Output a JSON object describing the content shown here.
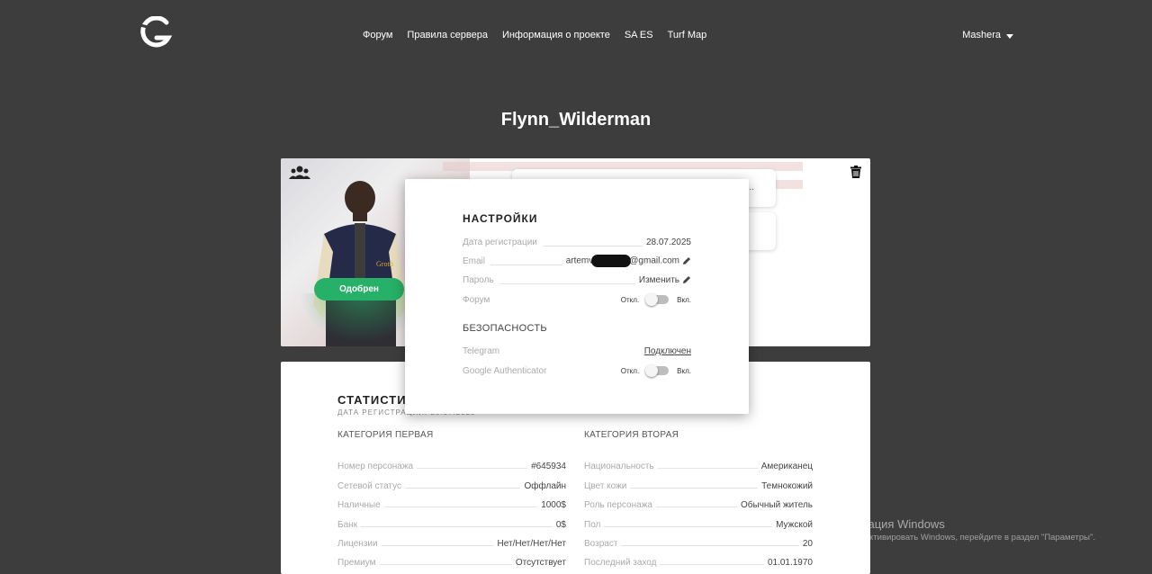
{
  "header": {
    "logo_icon": "g-logo-icon",
    "nav": [
      "Форум",
      "Правила сервера",
      "Информация о проекте",
      "SA ES",
      "Turf Map"
    ],
    "user_name": "Mashera"
  },
  "page": {
    "title": "Flynn_Wilderman"
  },
  "profile": {
    "status_label": "Одобрен",
    "status_color": "#27b067",
    "info_box_text": "..."
  },
  "settings": {
    "title": "НАСТРОЙКИ",
    "reg_label": "Дата регистрации",
    "reg_value": "28.07.2025",
    "email_label": "Email",
    "email_prefix": "artemv",
    "email_suffix": "gmail.com",
    "password_label": "Пароль",
    "password_action": "Изменить",
    "forum_label": "Форум",
    "toggle_off": "Откл.",
    "toggle_on": "Вкл.",
    "security_title": "БЕЗОПАСНОСТЬ",
    "telegram_label": "Telegram",
    "telegram_value": "Подключен",
    "ga_label": "Google Authenticator"
  },
  "stats": {
    "title": "СТАТИСТИК",
    "subtitle": "ДАТА РЕГИСТРАЦИИ: 28.07.2025",
    "left": {
      "title": "КАТЕГОРИЯ ПЕРВАЯ",
      "rows": [
        {
          "label": "Номер персонажа",
          "value": "#645934"
        },
        {
          "label": "Сетевой статус",
          "value": "Оффлайн"
        },
        {
          "label": "Наличные",
          "value": "1000$"
        },
        {
          "label": "Банк",
          "value": "0$"
        },
        {
          "label": "Лицензии",
          "value": "Нет/Нет/Нет/Нет"
        },
        {
          "label": "Премиум",
          "value": "Отсутствует"
        }
      ]
    },
    "right": {
      "title": "КАТЕГОРИЯ ВТОРАЯ",
      "rows": [
        {
          "label": "Национальность",
          "value": "Американец"
        },
        {
          "label": "Цвет кожи",
          "value": "Темнокожий"
        },
        {
          "label": "Роль персонажа",
          "value": "Обычный житель"
        },
        {
          "label": "Пол",
          "value": "Мужской"
        },
        {
          "label": "Возраст",
          "value": "20"
        },
        {
          "label": "Последний заход",
          "value": "01.01.1970"
        }
      ]
    }
  },
  "watermark": {
    "title": "Активация Windows",
    "subtitle": "Чтобы активировать Windows, перейдите в раздел \"Параметры\"."
  }
}
